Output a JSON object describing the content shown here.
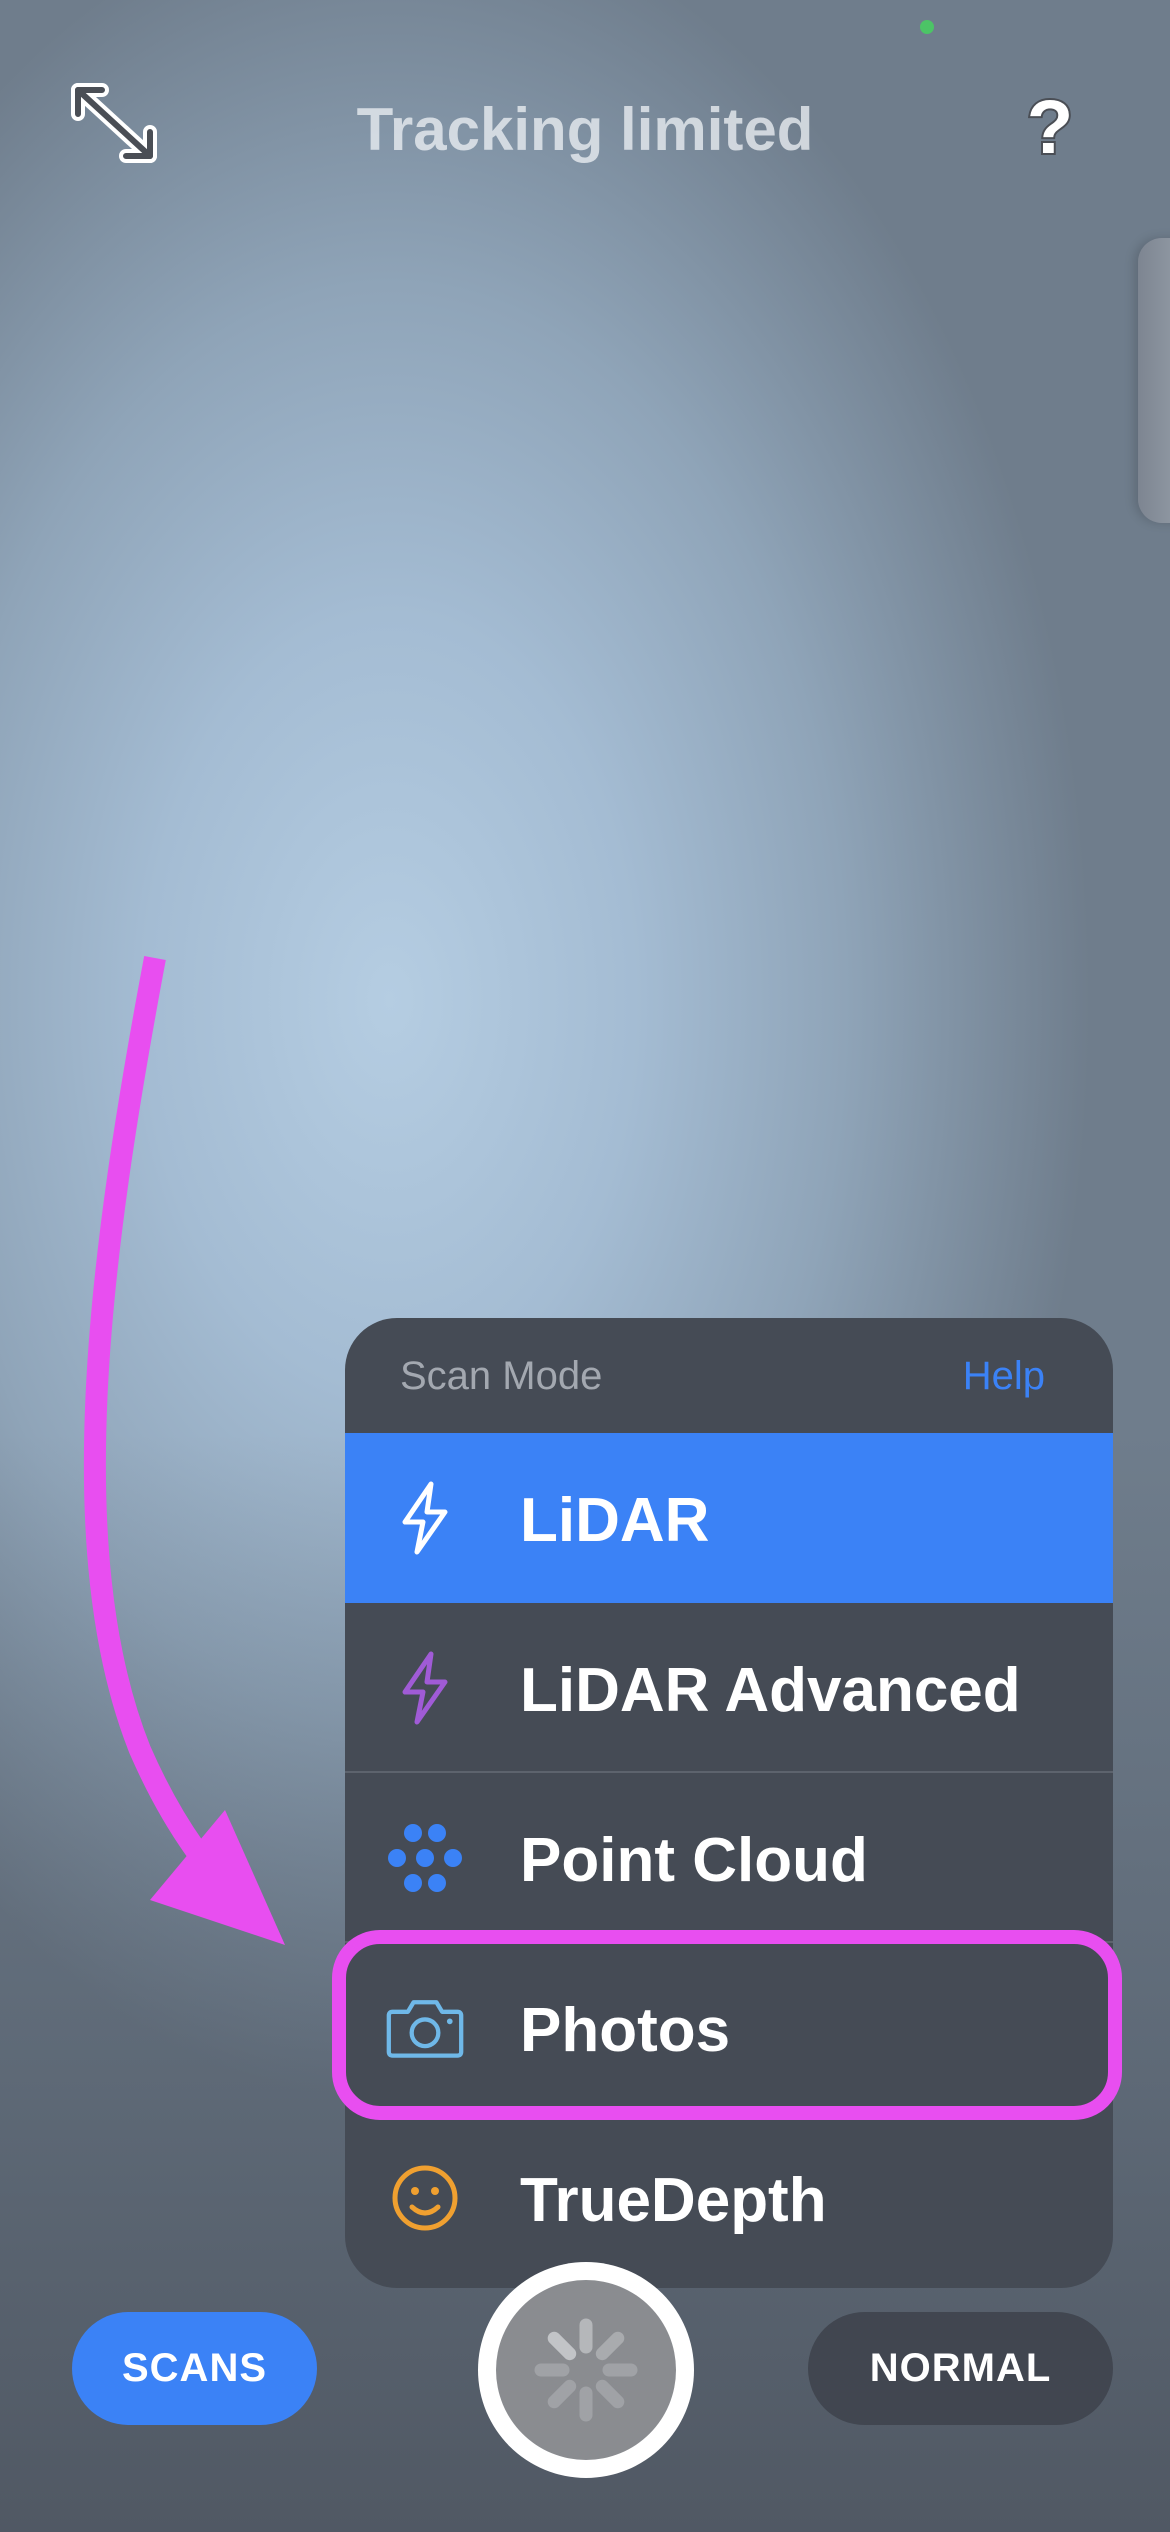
{
  "header": {
    "title": "Tracking limited",
    "help_glyph": "?"
  },
  "menu": {
    "header_label": "Scan Mode",
    "help_label": "Help",
    "items": [
      {
        "label": "LiDAR",
        "icon": "bolt-icon",
        "selected": true
      },
      {
        "label": "LiDAR Advanced",
        "icon": "bolt-outline-icon",
        "selected": false
      },
      {
        "label": "Point Cloud",
        "icon": "dots-icon",
        "selected": false
      },
      {
        "label": "Photos",
        "icon": "camera-icon",
        "selected": false,
        "highlighted": true
      },
      {
        "label": "TrueDepth",
        "icon": "smiley-icon",
        "selected": false
      }
    ]
  },
  "bottom_bar": {
    "scans_label": "SCANS",
    "normal_label": "NORMAL"
  },
  "colors": {
    "accent": "#3b82f6",
    "menu_bg": "#454b55",
    "highlight": "#e84ef0",
    "lidar_advanced_icon": "#a05bd6",
    "photos_icon": "#6fb8e8",
    "truedepth_icon": "#f0a030"
  }
}
